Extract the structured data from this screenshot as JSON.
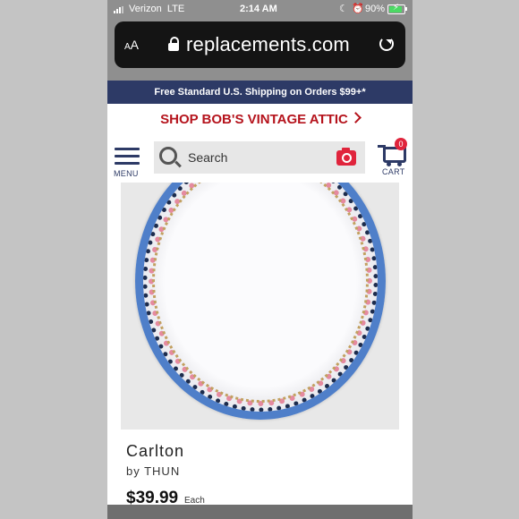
{
  "status_bar": {
    "carrier": "Verizon",
    "network": "LTE",
    "time": "2:14 AM",
    "battery": "90%",
    "battery_level": 0.9
  },
  "browser": {
    "text_size_button": "AA",
    "url": "replacements.com"
  },
  "site": {
    "promo_text": "Free Standard U.S. Shipping on Orders $99+*",
    "shop_link": "SHOP BOB'S VINTAGE ATTIC",
    "menu_label": "MENU",
    "search_placeholder": "Search",
    "cart_label": "CART",
    "cart_count": "0"
  },
  "product": {
    "name": "Carlton",
    "brand_line": "by THUN",
    "price": "$39.99",
    "price_unit": "Each"
  },
  "colors": {
    "navy": "#2d3a66",
    "red": "#b5131c",
    "camera_red": "#e0243c"
  }
}
